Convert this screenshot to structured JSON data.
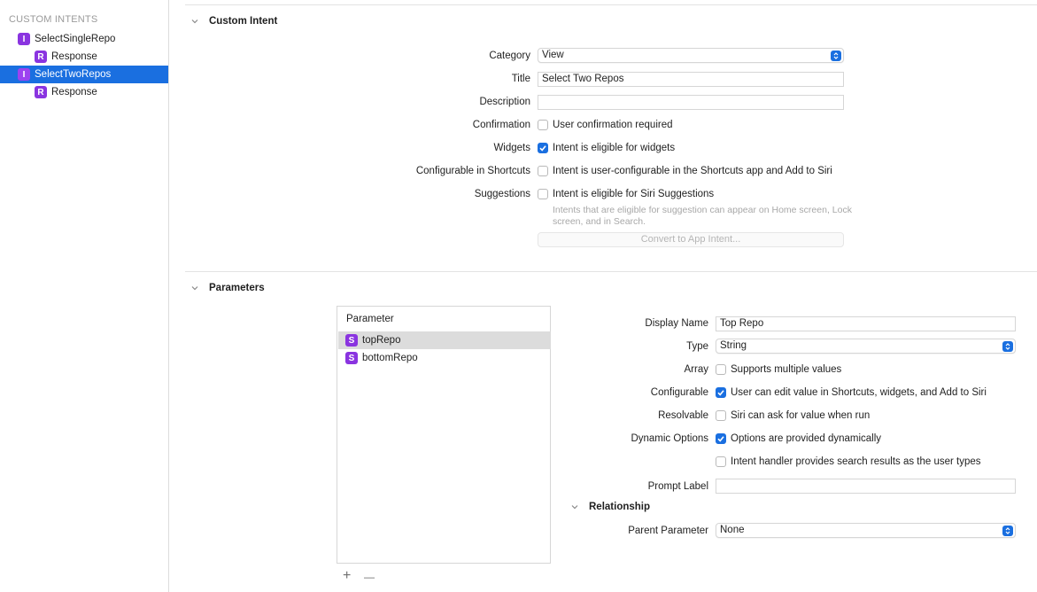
{
  "sidebar": {
    "header": "CUSTOM INTENTS",
    "items": [
      {
        "badge": "I",
        "label": "SelectSingleRepo"
      },
      {
        "badge": "R",
        "label": "Response"
      },
      {
        "badge": "I",
        "label": "SelectTwoRepos"
      },
      {
        "badge": "R",
        "label": "Response"
      }
    ]
  },
  "intent": {
    "section_title": "Custom Intent",
    "category_label": "Category",
    "category_value": "View",
    "title_label": "Title",
    "title_value": "Select Two Repos",
    "description_label": "Description",
    "description_value": "",
    "confirmation_label": "Confirmation",
    "confirmation_text": "User confirmation required",
    "widgets_label": "Widgets",
    "widgets_text": "Intent is eligible for widgets",
    "configurable_label": "Configurable in Shortcuts",
    "configurable_text": "Intent is user-configurable in the Shortcuts app and Add to Siri",
    "suggestions_label": "Suggestions",
    "suggestions_text": "Intent is eligible for Siri Suggestions",
    "suggestions_hint": "Intents that are eligible for suggestion can appear on Home screen, Lock screen, and in Search.",
    "convert_button": "Convert to App Intent..."
  },
  "parameters": {
    "section_title": "Parameters",
    "list_header": "Parameter",
    "items": [
      {
        "badge": "S",
        "label": "topRepo"
      },
      {
        "badge": "S",
        "label": "bottomRepo"
      }
    ],
    "add_symbol": "+",
    "remove_symbol": "—",
    "display_name_label": "Display Name",
    "display_name_value": "Top Repo",
    "type_label": "Type",
    "type_value": "String",
    "array_label": "Array",
    "array_text": "Supports multiple values",
    "configurable_label": "Configurable",
    "configurable_text": "User can edit value in Shortcuts, widgets, and Add to Siri",
    "resolvable_label": "Resolvable",
    "resolvable_text": "Siri can ask for value when run",
    "dynamic_label": "Dynamic Options",
    "dynamic_text": "Options are provided dynamically",
    "search_text": "Intent handler provides search results as the user types",
    "prompt_label": "Prompt Label",
    "prompt_value": "",
    "relationship_title": "Relationship",
    "parent_label": "Parent Parameter",
    "parent_value": "None"
  },
  "colors": {
    "accent": "#1a6fe0",
    "badge_purple": "#8a34e0"
  }
}
